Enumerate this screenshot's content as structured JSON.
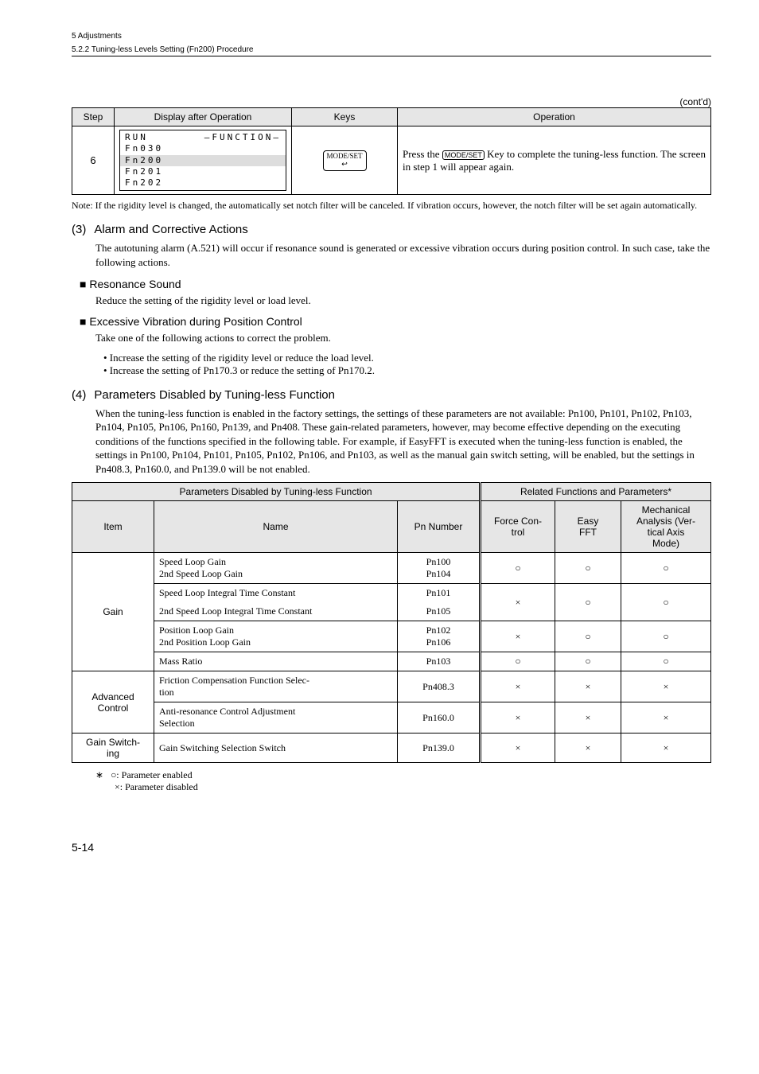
{
  "header": {
    "chapter": "5  Adjustments",
    "section": "5.2.2  Tuning-less Levels Setting (Fn200) Procedure"
  },
  "contd": "(cont'd)",
  "step_table": {
    "headers": {
      "step": "Step",
      "display": "Display after Operation",
      "keys": "Keys",
      "operation": "Operation"
    },
    "row": {
      "step": "6",
      "display": {
        "l1a": "RUN",
        "l1b": "—FUNCTION—",
        "l2": "Fn030",
        "l3": "Fn200",
        "l4": "Fn201",
        "l5": "Fn202"
      },
      "keys_label": "MODE/SET",
      "op_a": "Press the ",
      "op_key": "MODE/SET",
      "op_b": " Key to complete the tuning-less function. The screen in step 1 will appear again."
    }
  },
  "note": "Note: If the rigidity level is changed, the automatically set notch filter will be canceled. If vibration occurs, however, the notch filter will be set again automatically.",
  "s3": {
    "title": "Alarm and Corrective Actions",
    "num": "(3)",
    "body": "The autotuning alarm (A.521) will occur if resonance sound is generated or excessive vibration occurs during position control. In such case, take the following actions.",
    "h1": "Resonance Sound",
    "h1_body": "Reduce the setting of the rigidity level or load level.",
    "h2": "Excessive Vibration during Position Control",
    "h2_body": "Take one of the following actions to correct the problem.",
    "b1": "• Increase the setting of the rigidity level or reduce the load level.",
    "b2": "• Increase the setting of Pn170.3 or reduce the setting of Pn170.2."
  },
  "s4": {
    "title": "Parameters Disabled by Tuning-less Function",
    "num": "(4)",
    "body": "When the tuning-less function is enabled in the factory settings, the settings of these parameters are not available: Pn100, Pn101, Pn102, Pn103, Pn104, Pn105, Pn106, Pn160, Pn139, and Pn408. These gain-related parameters, however, may become effective depending on the executing conditions of the functions specified in the following table. For example, if EasyFFT is executed when the tuning-less function is enabled, the settings in Pn100, Pn104, Pn101, Pn105, Pn102, Pn106, and Pn103, as well as the manual gain switch setting, will be enabled, but the settings in Pn408.3, Pn160.0, and Pn139.0 will be not enabled."
  },
  "params_table": {
    "h_left": "Parameters Disabled by Tuning-less Function",
    "h_right": "Related Functions and Parameters*",
    "cols": {
      "item": "Item",
      "name": "Name",
      "pn": "Pn Number",
      "force": "Force Control",
      "easy": "Easy FFT",
      "mech": "Mechanical Analysis (Vertical Axis Mode)"
    },
    "gain_label": "Gain",
    "adv_label": "Advanced Control",
    "gs_label": "Gain Switching",
    "rows": {
      "r1": {
        "name": "Speed Loop Gain\n2nd Speed Loop Gain",
        "pn": "Pn100\nPn104",
        "f": "○",
        "e": "○",
        "m": "○"
      },
      "r2a": {
        "name": "Speed Loop Integral Time Constant",
        "pn": "Pn101"
      },
      "r2b": {
        "name": "2nd Speed Loop Integral Time Constant",
        "pn": "Pn105",
        "f": "×",
        "e": "○",
        "m": "○"
      },
      "r3": {
        "name": "Position Loop Gain\n2nd Position Loop Gain",
        "pn": "Pn102\nPn106",
        "f": "×",
        "e": "○",
        "m": "○"
      },
      "r4": {
        "name": "Mass Ratio",
        "pn": "Pn103",
        "f": "○",
        "e": "○",
        "m": "○"
      },
      "r5": {
        "name": "Friction Compensation Function Selection",
        "pn": "Pn408.3",
        "f": "×",
        "e": "×",
        "m": "×"
      },
      "r6": {
        "name": "Anti-resonance Control Adjustment Selection",
        "pn": "Pn160.0",
        "f": "×",
        "e": "×",
        "m": "×"
      },
      "r7": {
        "name": "Gain Switching Selection Switch",
        "pn": "Pn139.0",
        "f": "×",
        "e": "×",
        "m": "×"
      }
    }
  },
  "footnote": {
    "star": "∗",
    "l1": "○: Parameter enabled",
    "l2": "×: Parameter disabled"
  },
  "page_num": "5-14"
}
